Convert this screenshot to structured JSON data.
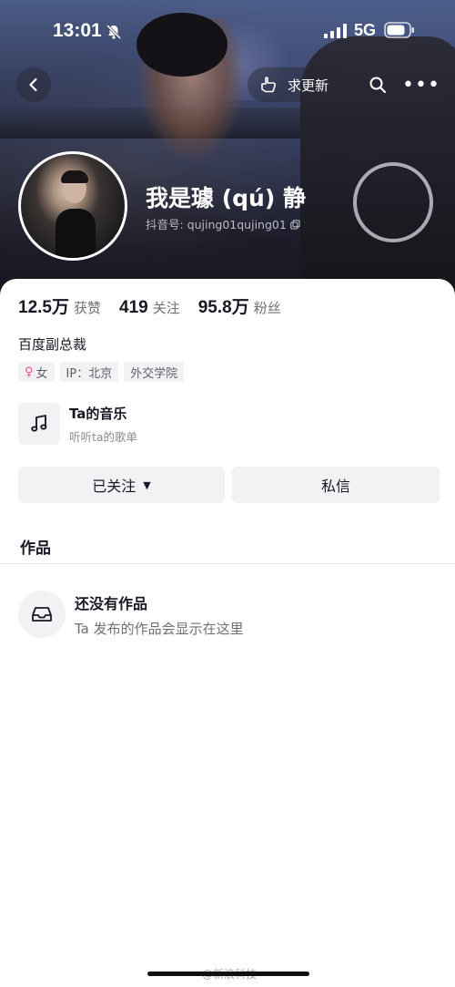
{
  "status_bar": {
    "time": "13:01",
    "network": "5G",
    "icons": [
      "bell-off-icon",
      "signal-icon",
      "battery-icon"
    ]
  },
  "top_nav": {
    "back_icon": "chevron-left-icon",
    "find_more_label": "求更新",
    "find_more_icon": "hand-point-icon",
    "search_icon": "search-icon",
    "more_icon": "more-dots-icon",
    "more_glyph": "•••"
  },
  "profile": {
    "name": "我是璩 (qú) 静",
    "id_label": "抖音号: qujing01qujing01"
  },
  "stats": [
    {
      "value": "12.5万",
      "label": "获赞"
    },
    {
      "value": "419",
      "label": "关注"
    },
    {
      "value": "95.8万",
      "label": "粉丝"
    }
  ],
  "bio": "百度副总裁",
  "tags": {
    "gender_icon": "♀",
    "gender": "女",
    "ip": "IP：北京",
    "school": "外交学院"
  },
  "music": {
    "title": "Ta的音乐",
    "subtitle": "听听ta的歌单"
  },
  "actions": {
    "follow_label": "已关注",
    "follow_caret": "▼",
    "message_label": "私信"
  },
  "works": {
    "title": "作品",
    "empty_title": "还没有作品",
    "empty_subtitle": "Ta 发布的作品会显示在这里"
  },
  "watermark": "@新浪科技",
  "colors": {
    "accent_pink": "#ea4c89",
    "text_primary": "#161823",
    "text_secondary": "#6e6f75",
    "chip_bg": "#f2f2f4"
  }
}
